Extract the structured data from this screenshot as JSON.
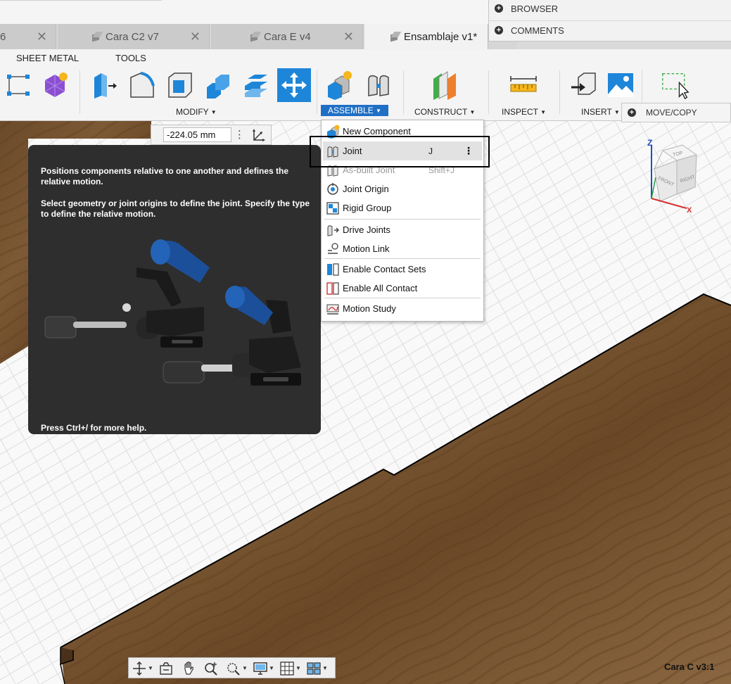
{
  "browser_panel": {
    "browser_label": "BROWSER",
    "comments_label": "COMMENTS"
  },
  "tabs": [
    {
      "label": "6"
    },
    {
      "label": "Cara C2 v7"
    },
    {
      "label": "Cara E v4"
    },
    {
      "label": "Ensamblaje v1*",
      "active": true
    }
  ],
  "ribbon": {
    "tabs": [
      "SHEET METAL",
      "TOOLS"
    ],
    "groups": {
      "modify": "MODIFY",
      "assemble": "ASSEMBLE",
      "construct": "CONSTRUCT",
      "inspect": "INSPECT",
      "insert": "INSERT"
    },
    "accent_color": "#1f6fc5"
  },
  "move_copy": {
    "label": "MOVE/COPY"
  },
  "measurement": {
    "value": "-224.05 mm"
  },
  "tooltip": {
    "paragraph1": "Positions components relative to one another and defines the relative motion.",
    "paragraph2": "Select geometry or joint origins to define the joint. Specify the type to define the relative motion.",
    "footer": "Press Ctrl+/ for more help."
  },
  "assemble_menu": {
    "items": [
      {
        "label": "New Component",
        "icon": "new-component-icon"
      },
      {
        "label": "Joint",
        "shortcut": "J",
        "icon": "joint-icon",
        "highlighted": true
      },
      {
        "label": "As-built Joint",
        "shortcut": "Shift+J",
        "icon": "as-built-joint-icon"
      },
      {
        "label": "Joint Origin",
        "icon": "joint-origin-icon"
      },
      {
        "label": "Rigid Group",
        "icon": "rigid-group-icon"
      },
      {
        "label": "Drive Joints",
        "icon": "drive-joints-icon"
      },
      {
        "label": "Motion Link",
        "icon": "motion-link-icon"
      },
      {
        "label": "Enable Contact Sets",
        "icon": "contact-sets-icon"
      },
      {
        "label": "Enable All Contact",
        "icon": "all-contact-icon"
      },
      {
        "label": "Motion Study",
        "icon": "motion-study-icon"
      }
    ]
  },
  "viewcube": {
    "top": "TOP",
    "front": "FRONT",
    "right": "RIGHT",
    "axis_z": "Z",
    "axis_x": "X"
  },
  "document_label": "Cara C v3:1"
}
